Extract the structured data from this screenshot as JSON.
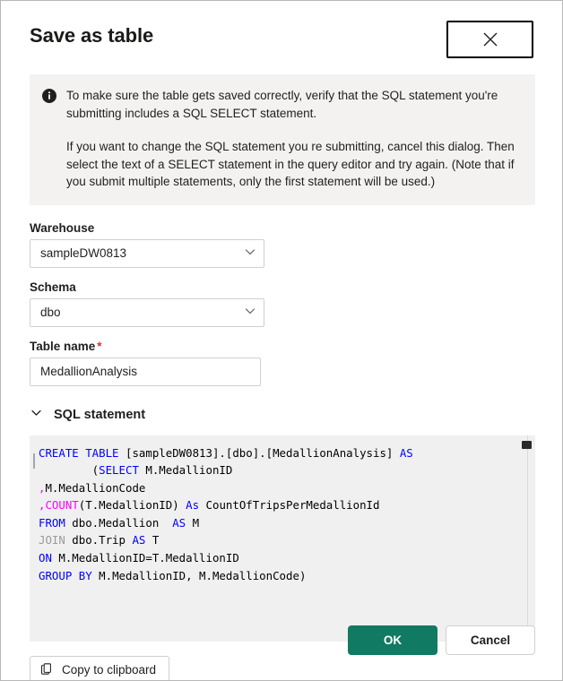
{
  "dialog": {
    "title": "Save as table",
    "close_label": "Close"
  },
  "info": {
    "icon": "info-icon",
    "paragraph1": "To make sure the table gets saved correctly, verify that the SQL statement you're submitting includes a SQL SELECT statement.",
    "paragraph2": "If you want to change the SQL statement you re submitting, cancel this dialog. Then select the text of a SELECT statement in the query editor and try again. (Note that if you submit multiple statements, only the first statement will be used.)"
  },
  "form": {
    "warehouse": {
      "label": "Warehouse",
      "value": "sampleDW0813",
      "icon": "chevron-down-icon"
    },
    "schema": {
      "label": "Schema",
      "value": "dbo",
      "icon": "chevron-down-icon"
    },
    "table_name": {
      "label": "Table name",
      "required_marker": "*",
      "value": "MedallionAnalysis"
    }
  },
  "sql_section": {
    "title": "SQL statement",
    "caret_icon": "chevron-down-icon",
    "expanded": true,
    "lines": [
      [
        {
          "t": "CREATE TABLE ",
          "c": "kw"
        },
        {
          "t": "[sampleDW0813].[dbo].[MedallionAnalysis] ",
          "c": ""
        },
        {
          "t": "AS",
          "c": "kw"
        }
      ],
      [
        {
          "t": "        (",
          "c": ""
        },
        {
          "t": "SELECT",
          "c": "kw"
        },
        {
          "t": " M.MedallionID",
          "c": ""
        }
      ],
      [
        {
          "t": ",",
          "c": "fn"
        },
        {
          "t": "M.MedallionCode",
          "c": ""
        }
      ],
      [
        {
          "t": ",",
          "c": "fn"
        },
        {
          "t": "COUNT",
          "c": "fn"
        },
        {
          "t": "(T.MedallionID) ",
          "c": ""
        },
        {
          "t": "As",
          "c": "kw"
        },
        {
          "t": " CountOfTripsPerMedallionId",
          "c": ""
        }
      ],
      [
        {
          "t": "FROM",
          "c": "kw"
        },
        {
          "t": " dbo.Medallion  ",
          "c": ""
        },
        {
          "t": "AS",
          "c": "kw"
        },
        {
          "t": " M",
          "c": ""
        }
      ],
      [
        {
          "t": "JOIN",
          "c": "kw-dim"
        },
        {
          "t": " dbo.Trip ",
          "c": ""
        },
        {
          "t": "AS",
          "c": "kw"
        },
        {
          "t": " T",
          "c": ""
        }
      ],
      [
        {
          "t": "ON",
          "c": "kw"
        },
        {
          "t": " M.MedallionID=T.MedallionID",
          "c": ""
        }
      ],
      [
        {
          "t": "GROUP BY",
          "c": "kw"
        },
        {
          "t": " M.MedallionID, M.MedallionCode)",
          "c": ""
        }
      ]
    ]
  },
  "actions": {
    "copy": {
      "label": "Copy to clipboard",
      "icon": "copy-icon"
    },
    "ok": "OK",
    "cancel": "Cancel"
  },
  "colors": {
    "primary": "#107a63",
    "info_bg": "#f3f2f1",
    "code_bg": "#f0f0f0",
    "keyword": "#0000ff",
    "function": "#ff00ff",
    "required": "#d13438"
  }
}
